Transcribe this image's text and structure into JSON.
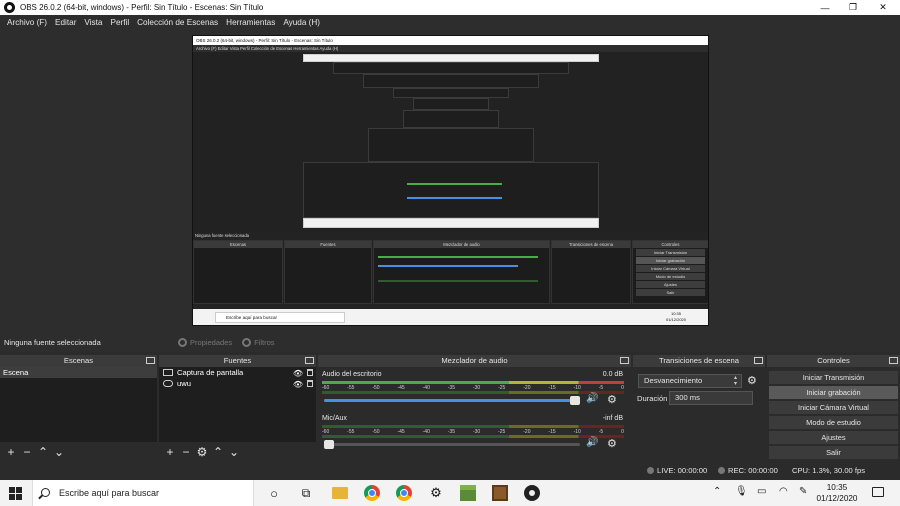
{
  "window": {
    "title": "OBS 26.0.2 (64-bit, windows) - Perfil: Sin Título - Escenas: Sin Título",
    "controls": {
      "minimize": "—",
      "maximize": "❐",
      "close": "✕"
    }
  },
  "menu": {
    "items": [
      "Archivo (F)",
      "Editar",
      "Vista",
      "Perfil",
      "Colección de Escenas",
      "Herramientas",
      "Ayuda (H)"
    ]
  },
  "preview_nested": {
    "title": "OBS 26.0.2 (64-bit, windows) - Perfil: Sin Título - Escenas: Sin Título",
    "menu": "Archivo (F)   Editar   Vista   Perfil   Colección de Escenas   Herramientas   Ayuda (H)",
    "context": "Ninguna fuente seleccionada",
    "docks": [
      "Escenas",
      "Fuentes",
      "Mezclador de audio",
      "Transiciones de escena",
      "Controles"
    ],
    "control_buttons": [
      "Iniciar Transmisión",
      "Iniciar grabación",
      "Iniciar Cámara Virtual",
      "Modo de estudio",
      "Ajustes",
      "Salir"
    ],
    "taskbar_search": "Escribe aquí para buscar",
    "clock_time": "10:35",
    "clock_date": "01/12/2020"
  },
  "context_bar": {
    "label": "Ninguna fuente seleccionada",
    "properties": "Propiedades",
    "filters": "Filtros"
  },
  "scenes": {
    "header": "Escenas",
    "items": [
      "Escena"
    ],
    "footer_icons": [
      "add-icon",
      "remove-icon",
      "up-icon",
      "down-icon"
    ]
  },
  "sources": {
    "header": "Fuentes",
    "items": [
      {
        "label": "Captura de pantalla",
        "icon": "monitor-icon"
      },
      {
        "label": "uwu",
        "icon": "link-icon"
      }
    ]
  },
  "mixer": {
    "header": "Mezclador de audio",
    "ticks": [
      "-60",
      "-55",
      "-50",
      "-45",
      "-40",
      "-35",
      "-30",
      "-25",
      "-20",
      "-15",
      "-10",
      "-5",
      "0"
    ],
    "channels": [
      {
        "name": "Audio del escritorio",
        "db": "0.0 dB",
        "volume": 1.0
      },
      {
        "name": "Mic/Aux",
        "db": "-inf dB",
        "volume": 0.0
      }
    ]
  },
  "transitions": {
    "header": "Transiciones de escena",
    "selected": "Desvanecimiento",
    "duration_label": "Duración",
    "duration_value": "300 ms"
  },
  "controls": {
    "header": "Controles",
    "buttons": [
      "Iniciar Transmisión",
      "Iniciar grabación",
      "Iniciar Cámara Virtual",
      "Modo de estudio",
      "Ajustes",
      "Salir"
    ]
  },
  "status": {
    "live": "LIVE: 00:00:00",
    "rec": "REC: 00:00:00",
    "cpu": "CPU: 1.3%, 30.00 fps"
  },
  "taskbar": {
    "search_placeholder": "Escribe aquí para buscar",
    "time": "10:35",
    "date": "01/12/2020"
  }
}
